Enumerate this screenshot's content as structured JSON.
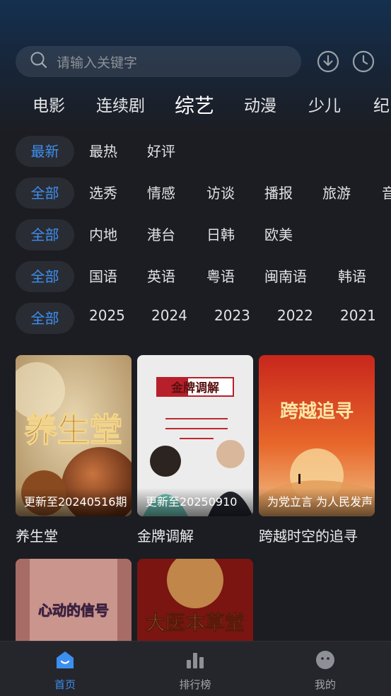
{
  "search": {
    "placeholder": "请输入关键字",
    "icons": [
      "search-icon",
      "download-icon",
      "history-icon"
    ]
  },
  "category_tabs": [
    {
      "label": "电影",
      "active": false
    },
    {
      "label": "连续剧",
      "active": false
    },
    {
      "label": "综艺",
      "active": true
    },
    {
      "label": "动漫",
      "active": false
    },
    {
      "label": "少儿",
      "active": false
    },
    {
      "label": "纪",
      "active": false
    }
  ],
  "filters": {
    "sort": [
      "最新",
      "最热",
      "好评"
    ],
    "type": [
      "全部",
      "选秀",
      "情感",
      "访谈",
      "播报",
      "旅游",
      "音"
    ],
    "region": [
      "全部",
      "内地",
      "港台",
      "日韩",
      "欧美"
    ],
    "language": [
      "全部",
      "国语",
      "英语",
      "粤语",
      "闽南语",
      "韩语"
    ],
    "year": [
      "全部",
      "2025",
      "2024",
      "2023",
      "2022",
      "2021"
    ]
  },
  "shows": [
    {
      "title": "养生堂",
      "caption": "更新至20240516期",
      "poster_text": "养生堂"
    },
    {
      "title": "金牌调解",
      "caption": "更新至20250910",
      "poster_text": "金牌调解"
    },
    {
      "title": "跨越时空的追寻",
      "caption": "为党立言 为人民发声",
      "poster_text": "跨越追寻"
    },
    {
      "title": "",
      "caption": "",
      "poster_text": "心动的信号"
    },
    {
      "title": "",
      "caption": "",
      "poster_text": "大医本草堂"
    }
  ],
  "bottom_nav": [
    {
      "label": "首页",
      "icon": "home-icon",
      "active": true
    },
    {
      "label": "排行榜",
      "icon": "ranking-icon",
      "active": false
    },
    {
      "label": "我的",
      "icon": "profile-icon",
      "active": false
    }
  ],
  "colors": {
    "background": "#1c1d22",
    "accent": "#3d8ff0",
    "chip_bg": "#2a2c33"
  }
}
